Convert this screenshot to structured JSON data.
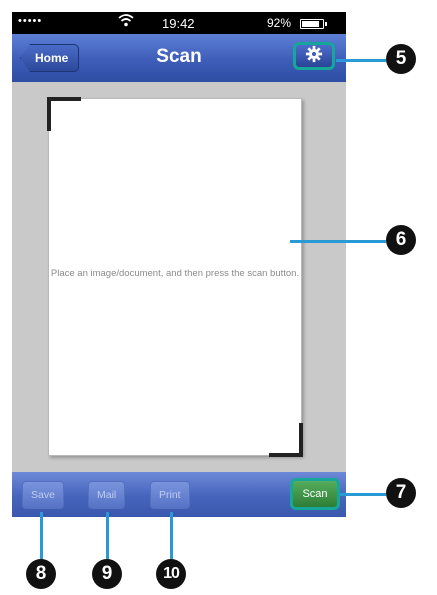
{
  "status_bar": {
    "signal": "•••••",
    "time": "19:42",
    "battery": "92%"
  },
  "nav": {
    "home_label": "Home",
    "title": "Scan"
  },
  "preview": {
    "placeholder": "Place an image/document, and then press the scan button."
  },
  "toolbar": {
    "save_label": "Save",
    "mail_label": "Mail",
    "print_label": "Print",
    "scan_label": "Scan"
  },
  "callouts": [
    "5",
    "6",
    "7",
    "8",
    "9",
    "10"
  ],
  "colors": {
    "nav_blue": "#3d5db8",
    "callout_line": "#2a9ad6",
    "highlight_teal": "#17a79a",
    "scan_green": "#2d7e36"
  }
}
